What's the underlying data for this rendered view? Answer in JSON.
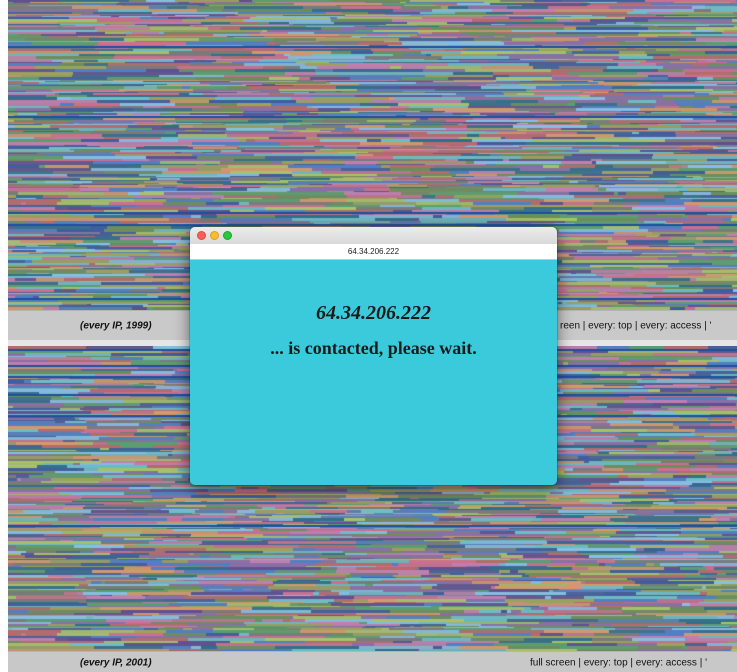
{
  "top_panel": {
    "caption_left": "(every IP, 1999)",
    "caption_right": "reen | every: top | every: access | '"
  },
  "bottom_panel": {
    "caption_left": "(every IP, 2001)",
    "caption_right": "full screen | every: top | every: access | '"
  },
  "popup": {
    "url": "64.34.206.222",
    "ip": "64.34.206.222",
    "message": "... is contacted, please wait.",
    "background_color": "#3bcadb",
    "traffic_lights": [
      "close-icon",
      "minimize-icon",
      "maximize-icon"
    ]
  }
}
